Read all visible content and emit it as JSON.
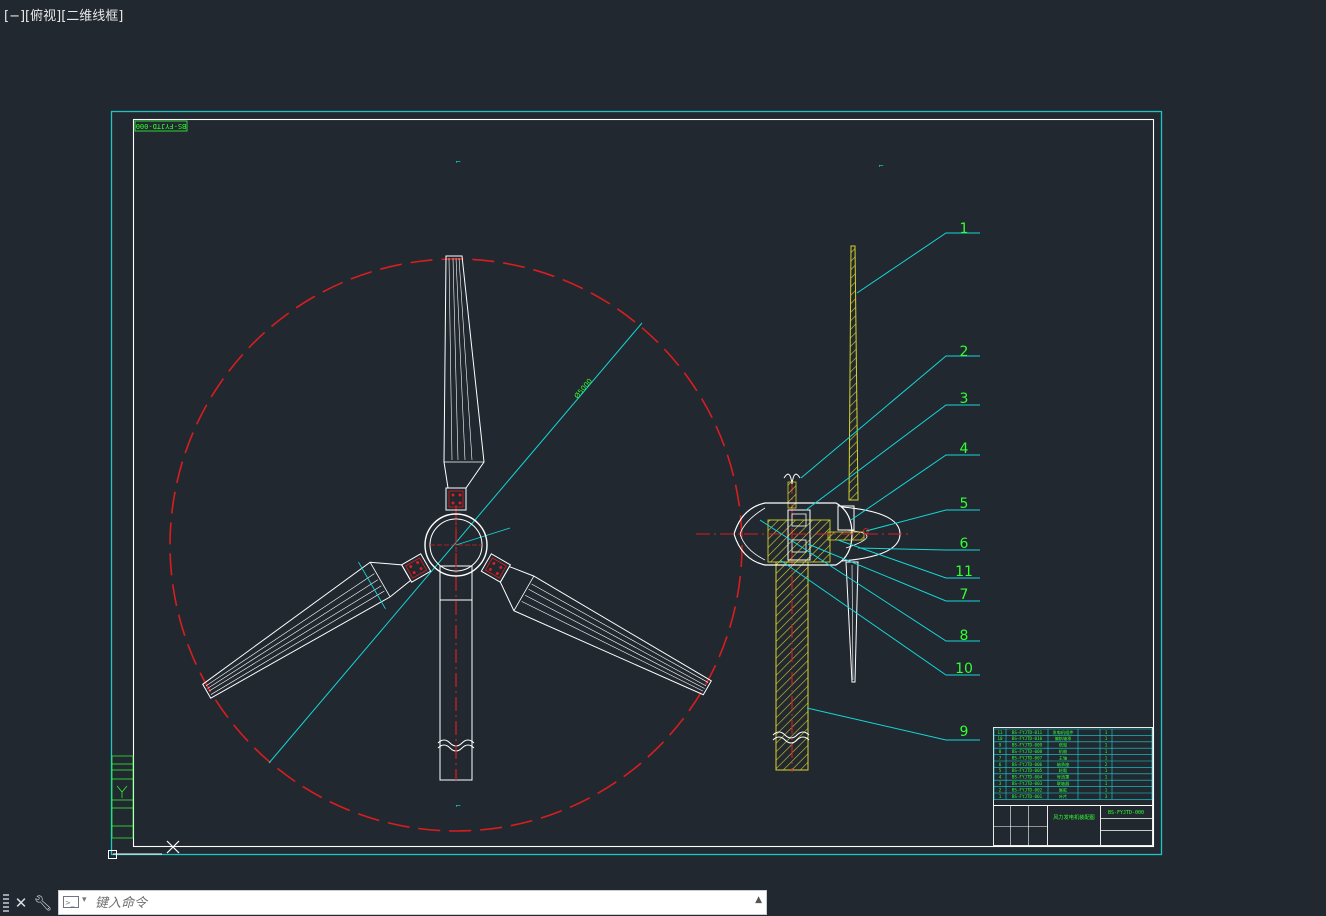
{
  "viewport": {
    "control": "[−]",
    "view": "[俯视]",
    "style": "[二维线框]"
  },
  "drawing": {
    "drawing_number": "BS-FYJTD-000",
    "drawing_title": "风力发电机装配图",
    "balloons": [
      "1",
      "2",
      "3",
      "4",
      "5",
      "6",
      "11",
      "7",
      "8",
      "10",
      "9"
    ],
    "dimension_text": "Ø5000",
    "bom_rows": [
      {
        "no": "11",
        "code": "BS-FYJTD-011",
        "name": "发电机组件",
        "qty": "1"
      },
      {
        "no": "10",
        "code": "BS-FYJTD-010",
        "name": "偏航轴承",
        "qty": "1"
      },
      {
        "no": "9",
        "code": "BS-FYJTD-009",
        "name": "塔架",
        "qty": "1"
      },
      {
        "no": "8",
        "code": "BS-FYJTD-008",
        "name": "机舱",
        "qty": "1"
      },
      {
        "no": "7",
        "code": "BS-FYJTD-007",
        "name": "主轴",
        "qty": "1"
      },
      {
        "no": "6",
        "code": "BS-FYJTD-006",
        "name": "轴承座",
        "qty": "2"
      },
      {
        "no": "5",
        "code": "BS-FYJTD-005",
        "name": "轮毂",
        "qty": "1"
      },
      {
        "no": "4",
        "code": "BS-FYJTD-004",
        "name": "导流罩",
        "qty": "1"
      },
      {
        "no": "3",
        "code": "BS-FYJTD-003",
        "name": "联轴器",
        "qty": "1"
      },
      {
        "no": "2",
        "code": "BS-FYJTD-002",
        "name": "尾舵",
        "qty": "1"
      },
      {
        "no": "1",
        "code": "BS-FYJTD-001",
        "name": "叶片",
        "qty": "3"
      }
    ],
    "colors": {
      "frame_outer": "#20c4c4",
      "frame_inner": "#ffffff",
      "leader": "#16d6d6",
      "balloon_text": "#33ff33",
      "hidden_circle": "#d81e1e",
      "hatch": "#d6d22e"
    }
  },
  "command_line": {
    "close_icon": "close-icon",
    "settings_icon": "wrench-icon",
    "placeholder": "键入命令"
  }
}
